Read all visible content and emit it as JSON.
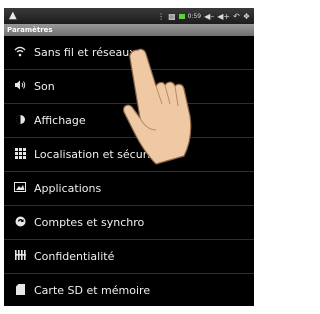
{
  "statusbar": {
    "time": "0:59"
  },
  "title": "Paramètres",
  "items": [
    {
      "label": "Sans fil et réseaux",
      "icon": "wifi-icon"
    },
    {
      "label": "Son",
      "icon": "speaker-icon"
    },
    {
      "label": "Affichage",
      "icon": "brightness-icon"
    },
    {
      "label": "Localisation et sécurité",
      "icon": "location-grid-icon"
    },
    {
      "label": "Applications",
      "icon": "applications-icon"
    },
    {
      "label": "Comptes et synchro",
      "icon": "sync-icon"
    },
    {
      "label": "Confidentialité",
      "icon": "privacy-icon"
    },
    {
      "label": "Carte SD et mémoire",
      "icon": "sd-card-icon"
    }
  ]
}
